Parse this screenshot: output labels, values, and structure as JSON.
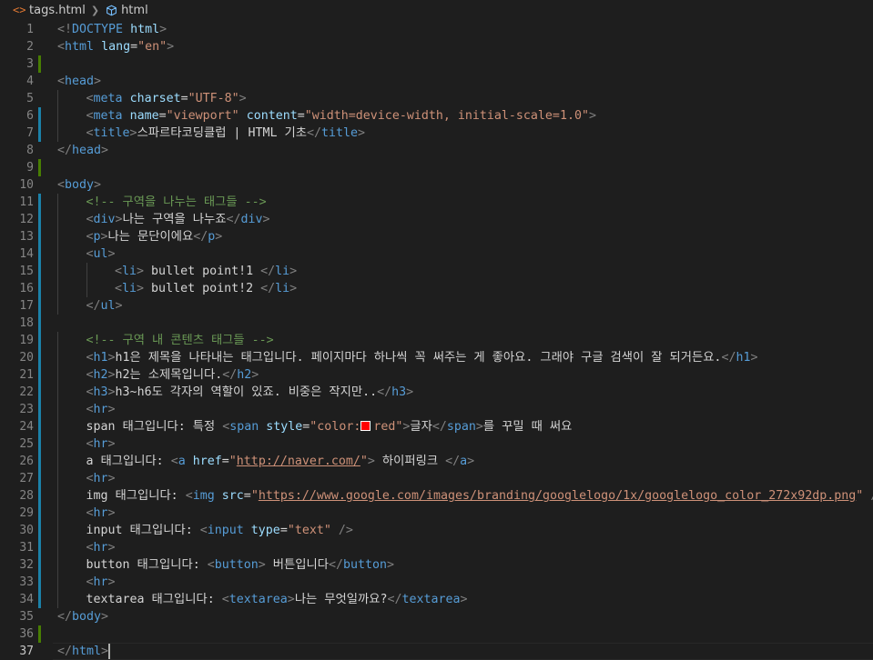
{
  "breadcrumb": {
    "file_icon": "<>",
    "file_name": "tags.html",
    "separator_icon": "chevron-right-icon",
    "symbol_icon": "cube-icon",
    "symbol_name": "html"
  },
  "colors": {
    "background": "#1e1e1e",
    "tag": "#569cd6",
    "bracket": "#808080",
    "attribute": "#9cdcfe",
    "string": "#ce9178",
    "comment": "#6a9955",
    "text": "#d4d4d4",
    "git_added": "#487e02",
    "git_modified": "#1b81a8",
    "color_swatch": "#ff0000"
  },
  "current_line": 37,
  "lines": [
    {
      "n": "1",
      "git": "",
      "indent": 0,
      "tokens": [
        [
          "b",
          "<!"
        ],
        [
          "t",
          "DOCTYPE"
        ],
        [
          "x",
          " "
        ],
        [
          "a",
          "html"
        ],
        [
          "b",
          ">"
        ]
      ]
    },
    {
      "n": "2",
      "git": "",
      "indent": 0,
      "tokens": [
        [
          "b",
          "<"
        ],
        [
          "t",
          "html"
        ],
        [
          "x",
          " "
        ],
        [
          "a",
          "lang"
        ],
        [
          "x",
          "="
        ],
        [
          "s",
          "\"en\""
        ],
        [
          "b",
          ">"
        ]
      ]
    },
    {
      "n": "3",
      "git": "added",
      "indent": 0,
      "tokens": []
    },
    {
      "n": "4",
      "git": "",
      "indent": 0,
      "tokens": [
        [
          "b",
          "<"
        ],
        [
          "t",
          "head"
        ],
        [
          "b",
          ">"
        ]
      ]
    },
    {
      "n": "5",
      "git": "",
      "indent": 1,
      "tokens": [
        [
          "b",
          "<"
        ],
        [
          "t",
          "meta"
        ],
        [
          "x",
          " "
        ],
        [
          "a",
          "charset"
        ],
        [
          "x",
          "="
        ],
        [
          "s",
          "\"UTF-8\""
        ],
        [
          "b",
          ">"
        ]
      ]
    },
    {
      "n": "6",
      "git": "modified",
      "indent": 1,
      "tokens": [
        [
          "b",
          "<"
        ],
        [
          "t",
          "meta"
        ],
        [
          "x",
          " "
        ],
        [
          "a",
          "name"
        ],
        [
          "x",
          "="
        ],
        [
          "s",
          "\"viewport\""
        ],
        [
          "x",
          " "
        ],
        [
          "a",
          "content"
        ],
        [
          "x",
          "="
        ],
        [
          "s",
          "\"width=device-width, initial-scale=1.0\""
        ],
        [
          "b",
          ">"
        ]
      ]
    },
    {
      "n": "7",
      "git": "modified",
      "indent": 1,
      "tokens": [
        [
          "b",
          "<"
        ],
        [
          "t",
          "title"
        ],
        [
          "b",
          ">"
        ],
        [
          "x",
          "스파르타코딩클럽 | HTML 기초"
        ],
        [
          "b",
          "</"
        ],
        [
          "t",
          "title"
        ],
        [
          "b",
          ">"
        ]
      ]
    },
    {
      "n": "8",
      "git": "",
      "indent": 0,
      "tokens": [
        [
          "b",
          "</"
        ],
        [
          "t",
          "head"
        ],
        [
          "b",
          ">"
        ]
      ]
    },
    {
      "n": "9",
      "git": "added",
      "indent": 0,
      "tokens": []
    },
    {
      "n": "10",
      "git": "",
      "indent": 0,
      "tokens": [
        [
          "b",
          "<"
        ],
        [
          "t",
          "body"
        ],
        [
          "b",
          ">"
        ]
      ]
    },
    {
      "n": "11",
      "git": "modified",
      "indent": 1,
      "tokens": [
        [
          "c",
          "<!-- 구역을 나누는 태그들 -->"
        ]
      ]
    },
    {
      "n": "12",
      "git": "modified",
      "indent": 1,
      "tokens": [
        [
          "b",
          "<"
        ],
        [
          "t",
          "div"
        ],
        [
          "b",
          ">"
        ],
        [
          "x",
          "나는 구역을 나누죠"
        ],
        [
          "b",
          "</"
        ],
        [
          "t",
          "div"
        ],
        [
          "b",
          ">"
        ]
      ]
    },
    {
      "n": "13",
      "git": "modified",
      "indent": 1,
      "tokens": [
        [
          "b",
          "<"
        ],
        [
          "t",
          "p"
        ],
        [
          "b",
          ">"
        ],
        [
          "x",
          "나는 문단이에요"
        ],
        [
          "b",
          "</"
        ],
        [
          "t",
          "p"
        ],
        [
          "b",
          ">"
        ]
      ]
    },
    {
      "n": "14",
      "git": "modified",
      "indent": 1,
      "tokens": [
        [
          "b",
          "<"
        ],
        [
          "t",
          "ul"
        ],
        [
          "b",
          ">"
        ]
      ]
    },
    {
      "n": "15",
      "git": "modified",
      "indent": 2,
      "tokens": [
        [
          "b",
          "<"
        ],
        [
          "t",
          "li"
        ],
        [
          "b",
          ">"
        ],
        [
          "x",
          " bullet point!1 "
        ],
        [
          "b",
          "</"
        ],
        [
          "t",
          "li"
        ],
        [
          "b",
          ">"
        ]
      ]
    },
    {
      "n": "16",
      "git": "modified",
      "indent": 2,
      "tokens": [
        [
          "b",
          "<"
        ],
        [
          "t",
          "li"
        ],
        [
          "b",
          ">"
        ],
        [
          "x",
          " bullet point!2 "
        ],
        [
          "b",
          "</"
        ],
        [
          "t",
          "li"
        ],
        [
          "b",
          ">"
        ]
      ]
    },
    {
      "n": "17",
      "git": "modified",
      "indent": 1,
      "tokens": [
        [
          "b",
          "</"
        ],
        [
          "t",
          "ul"
        ],
        [
          "b",
          ">"
        ]
      ]
    },
    {
      "n": "18",
      "git": "modified",
      "indent": 0,
      "tokens": []
    },
    {
      "n": "19",
      "git": "modified",
      "indent": 1,
      "tokens": [
        [
          "c",
          "<!-- 구역 내 콘텐츠 태그들 -->"
        ]
      ]
    },
    {
      "n": "20",
      "git": "modified",
      "indent": 1,
      "tokens": [
        [
          "b",
          "<"
        ],
        [
          "t",
          "h1"
        ],
        [
          "b",
          ">"
        ],
        [
          "x",
          "h1은 제목을 나타내는 태그입니다. 페이지마다 하나씩 꼭 써주는 게 좋아요. 그래야 구글 검색이 잘 되거든요."
        ],
        [
          "b",
          "</"
        ],
        [
          "t",
          "h1"
        ],
        [
          "b",
          ">"
        ]
      ]
    },
    {
      "n": "21",
      "git": "modified",
      "indent": 1,
      "tokens": [
        [
          "b",
          "<"
        ],
        [
          "t",
          "h2"
        ],
        [
          "b",
          ">"
        ],
        [
          "x",
          "h2는 소제목입니다."
        ],
        [
          "b",
          "</"
        ],
        [
          "t",
          "h2"
        ],
        [
          "b",
          ">"
        ]
      ]
    },
    {
      "n": "22",
      "git": "modified",
      "indent": 1,
      "tokens": [
        [
          "b",
          "<"
        ],
        [
          "t",
          "h3"
        ],
        [
          "b",
          ">"
        ],
        [
          "x",
          "h3~h6도 각자의 역할이 있죠. 비중은 작지만.."
        ],
        [
          "b",
          "</"
        ],
        [
          "t",
          "h3"
        ],
        [
          "b",
          ">"
        ]
      ]
    },
    {
      "n": "23",
      "git": "modified",
      "indent": 1,
      "tokens": [
        [
          "b",
          "<"
        ],
        [
          "t",
          "hr"
        ],
        [
          "b",
          ">"
        ]
      ]
    },
    {
      "n": "24",
      "git": "modified",
      "indent": 1,
      "tokens": [
        [
          "x",
          "span 태그입니다: 특정 "
        ],
        [
          "b",
          "<"
        ],
        [
          "t",
          "span"
        ],
        [
          "x",
          " "
        ],
        [
          "a",
          "style"
        ],
        [
          "x",
          "="
        ],
        [
          "s",
          "\"color:"
        ],
        [
          "swatch",
          ""
        ],
        [
          "s",
          "red\""
        ],
        [
          "b",
          ">"
        ],
        [
          "x",
          "글자"
        ],
        [
          "b",
          "</"
        ],
        [
          "t",
          "span"
        ],
        [
          "b",
          ">"
        ],
        [
          "x",
          "를 꾸밀 때 써요"
        ]
      ]
    },
    {
      "n": "25",
      "git": "modified",
      "indent": 1,
      "tokens": [
        [
          "b",
          "<"
        ],
        [
          "t",
          "hr"
        ],
        [
          "b",
          ">"
        ]
      ]
    },
    {
      "n": "26",
      "git": "modified",
      "indent": 1,
      "tokens": [
        [
          "x",
          "a 태그입니다: "
        ],
        [
          "b",
          "<"
        ],
        [
          "t",
          "a"
        ],
        [
          "x",
          " "
        ],
        [
          "a",
          "href"
        ],
        [
          "x",
          "="
        ],
        [
          "s",
          "\""
        ],
        [
          "u",
          "http://naver.com/"
        ],
        [
          "s",
          "\""
        ],
        [
          "b",
          ">"
        ],
        [
          "x",
          " 하이퍼링크 "
        ],
        [
          "b",
          "</"
        ],
        [
          "t",
          "a"
        ],
        [
          "b",
          ">"
        ]
      ]
    },
    {
      "n": "27",
      "git": "modified",
      "indent": 1,
      "tokens": [
        [
          "b",
          "<"
        ],
        [
          "t",
          "hr"
        ],
        [
          "b",
          ">"
        ]
      ]
    },
    {
      "n": "28",
      "git": "modified",
      "indent": 1,
      "tokens": [
        [
          "x",
          "img 태그입니다: "
        ],
        [
          "b",
          "<"
        ],
        [
          "t",
          "img"
        ],
        [
          "x",
          " "
        ],
        [
          "a",
          "src"
        ],
        [
          "x",
          "="
        ],
        [
          "s",
          "\""
        ],
        [
          "u",
          "https://www.google.com/images/branding/googlelogo/1x/googlelogo_color_272x92dp.png"
        ],
        [
          "s",
          "\""
        ],
        [
          "x",
          " "
        ],
        [
          "b",
          "/>"
        ]
      ]
    },
    {
      "n": "29",
      "git": "modified",
      "indent": 1,
      "tokens": [
        [
          "b",
          "<"
        ],
        [
          "t",
          "hr"
        ],
        [
          "b",
          ">"
        ]
      ]
    },
    {
      "n": "30",
      "git": "modified",
      "indent": 1,
      "tokens": [
        [
          "x",
          "input 태그입니다: "
        ],
        [
          "b",
          "<"
        ],
        [
          "t",
          "input"
        ],
        [
          "x",
          " "
        ],
        [
          "a",
          "type"
        ],
        [
          "x",
          "="
        ],
        [
          "s",
          "\"text\""
        ],
        [
          "x",
          " "
        ],
        [
          "b",
          "/>"
        ]
      ]
    },
    {
      "n": "31",
      "git": "modified",
      "indent": 1,
      "tokens": [
        [
          "b",
          "<"
        ],
        [
          "t",
          "hr"
        ],
        [
          "b",
          ">"
        ]
      ]
    },
    {
      "n": "32",
      "git": "modified",
      "indent": 1,
      "tokens": [
        [
          "x",
          "button 태그입니다: "
        ],
        [
          "b",
          "<"
        ],
        [
          "t",
          "button"
        ],
        [
          "b",
          ">"
        ],
        [
          "x",
          " 버튼입니다"
        ],
        [
          "b",
          "</"
        ],
        [
          "t",
          "button"
        ],
        [
          "b",
          ">"
        ]
      ]
    },
    {
      "n": "33",
      "git": "modified",
      "indent": 1,
      "tokens": [
        [
          "b",
          "<"
        ],
        [
          "t",
          "hr"
        ],
        [
          "b",
          ">"
        ]
      ]
    },
    {
      "n": "34",
      "git": "modified",
      "indent": 1,
      "tokens": [
        [
          "x",
          "textarea 태그입니다: "
        ],
        [
          "b",
          "<"
        ],
        [
          "t",
          "textarea"
        ],
        [
          "b",
          ">"
        ],
        [
          "x",
          "나는 무엇일까요?"
        ],
        [
          "b",
          "</"
        ],
        [
          "t",
          "textarea"
        ],
        [
          "b",
          ">"
        ]
      ]
    },
    {
      "n": "35",
      "git": "",
      "indent": 0,
      "tokens": [
        [
          "b",
          "</"
        ],
        [
          "t",
          "body"
        ],
        [
          "b",
          ">"
        ]
      ]
    },
    {
      "n": "36",
      "git": "added",
      "indent": 0,
      "tokens": []
    },
    {
      "n": "37",
      "git": "",
      "indent": 0,
      "tokens": [
        [
          "b",
          "</"
        ],
        [
          "t",
          "html"
        ],
        [
          "b",
          ">"
        ]
      ]
    }
  ]
}
